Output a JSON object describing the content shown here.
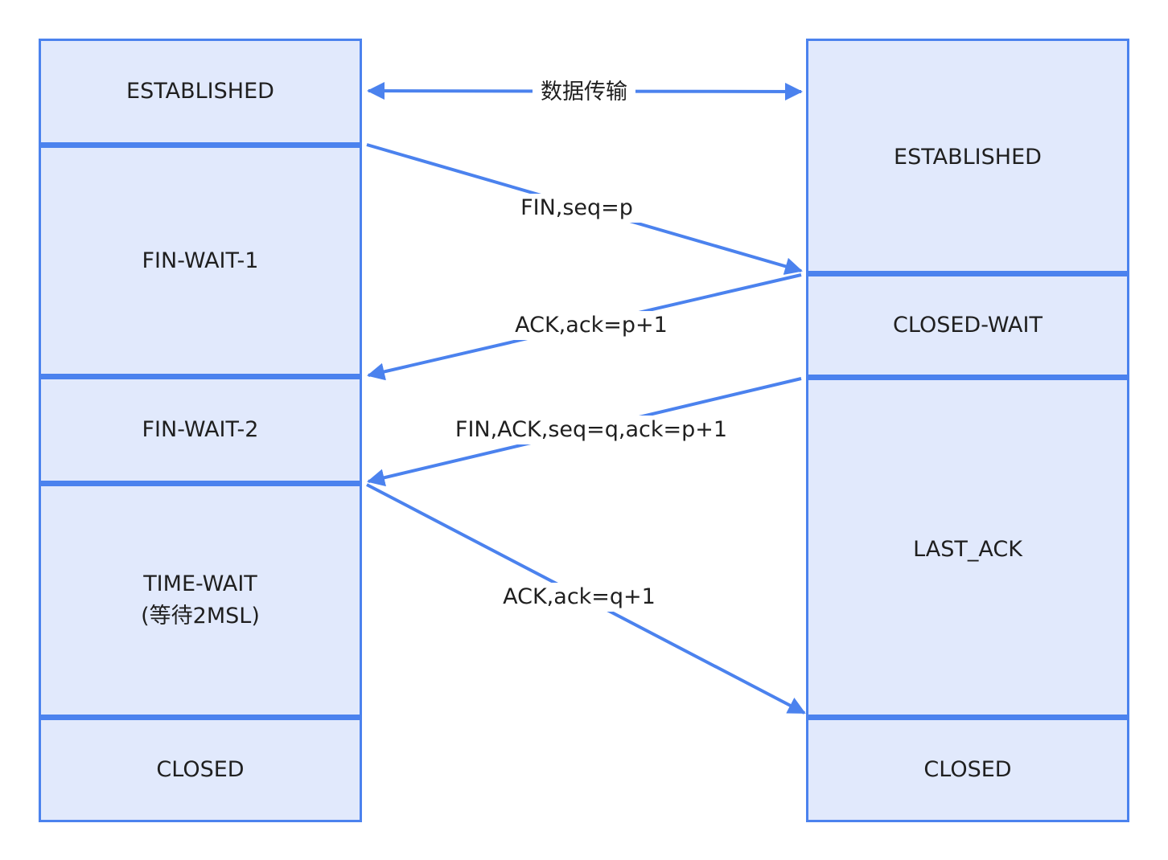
{
  "client": {
    "states": [
      {
        "label": "ESTABLISHED"
      },
      {
        "label": "FIN-WAIT-1"
      },
      {
        "label": "FIN-WAIT-2"
      },
      {
        "label": "TIME-WAIT\n(等待2MSL)"
      },
      {
        "label": "CLOSED"
      }
    ]
  },
  "server": {
    "states": [
      {
        "label": "ESTABLISHED"
      },
      {
        "label": "CLOSED-WAIT"
      },
      {
        "label": "LAST_ACK"
      },
      {
        "label": "CLOSED"
      }
    ]
  },
  "messages": {
    "data_transfer": "数据传输",
    "fin_1": "FIN,seq=p",
    "ack_1": "ACK,ack=p+1",
    "fin_2": "FIN,ACK,seq=q,ack=p+1",
    "ack_2": "ACK,ack=q+1"
  },
  "colors": {
    "accent": "#4b82ee",
    "fill": "#e1e9fc",
    "text": "#1f1f1f"
  }
}
